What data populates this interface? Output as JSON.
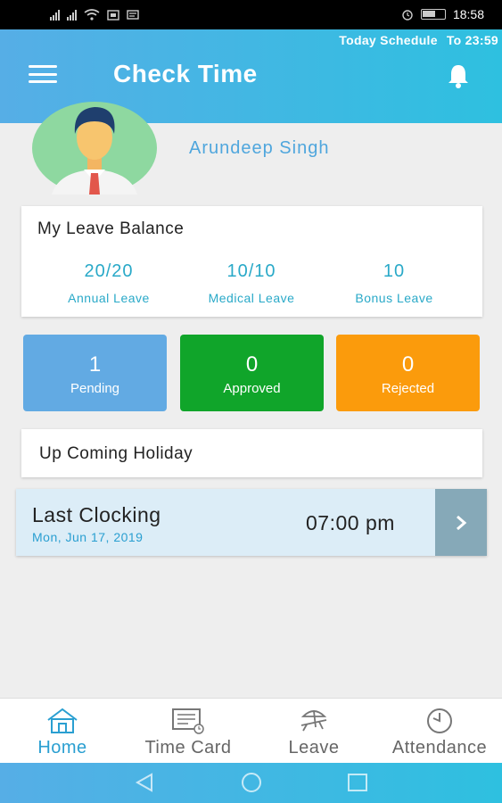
{
  "status_bar": {
    "time": "18:58"
  },
  "header": {
    "schedule_label": "Today Schedule",
    "schedule_time": "To 23:59",
    "title": "Check Time",
    "menu_icon": "hamburger-icon",
    "notify_icon": "bell-icon"
  },
  "profile": {
    "name": "Arundeep  Singh",
    "avatar_icon": "user-avatar"
  },
  "leave_balance": {
    "title": "My Leave Balance",
    "items": [
      {
        "value": "20/20",
        "label": "Annual Leave"
      },
      {
        "value": "10/10",
        "label": "Medical Leave"
      },
      {
        "value": "10",
        "label": "Bonus Leave"
      }
    ]
  },
  "status_tiles": [
    {
      "count": "1",
      "label": "Pending",
      "color": "#62aae3"
    },
    {
      "count": "0",
      "label": "Approved",
      "color": "#10a52a"
    },
    {
      "count": "0",
      "label": "Rejected",
      "color": "#fb9b0c"
    }
  ],
  "holiday": {
    "title": "Up Coming Holiday"
  },
  "last_clocking": {
    "title": "Last Clocking",
    "date": "Mon, Jun 17, 2019",
    "time": "07:00 pm",
    "action_icon": "chevron-right-icon"
  },
  "bottom_nav": [
    {
      "label": "Home",
      "icon": "home-icon",
      "active": true
    },
    {
      "label": "Time Card",
      "icon": "time-card-icon",
      "active": false
    },
    {
      "label": "Leave",
      "icon": "beach-chair-icon",
      "active": false
    },
    {
      "label": "Attendance",
      "icon": "clock-icon",
      "active": false
    }
  ],
  "colors": {
    "accent": "#2a9fd1",
    "header_start": "#56aee6",
    "header_end": "#2ec0e0"
  }
}
